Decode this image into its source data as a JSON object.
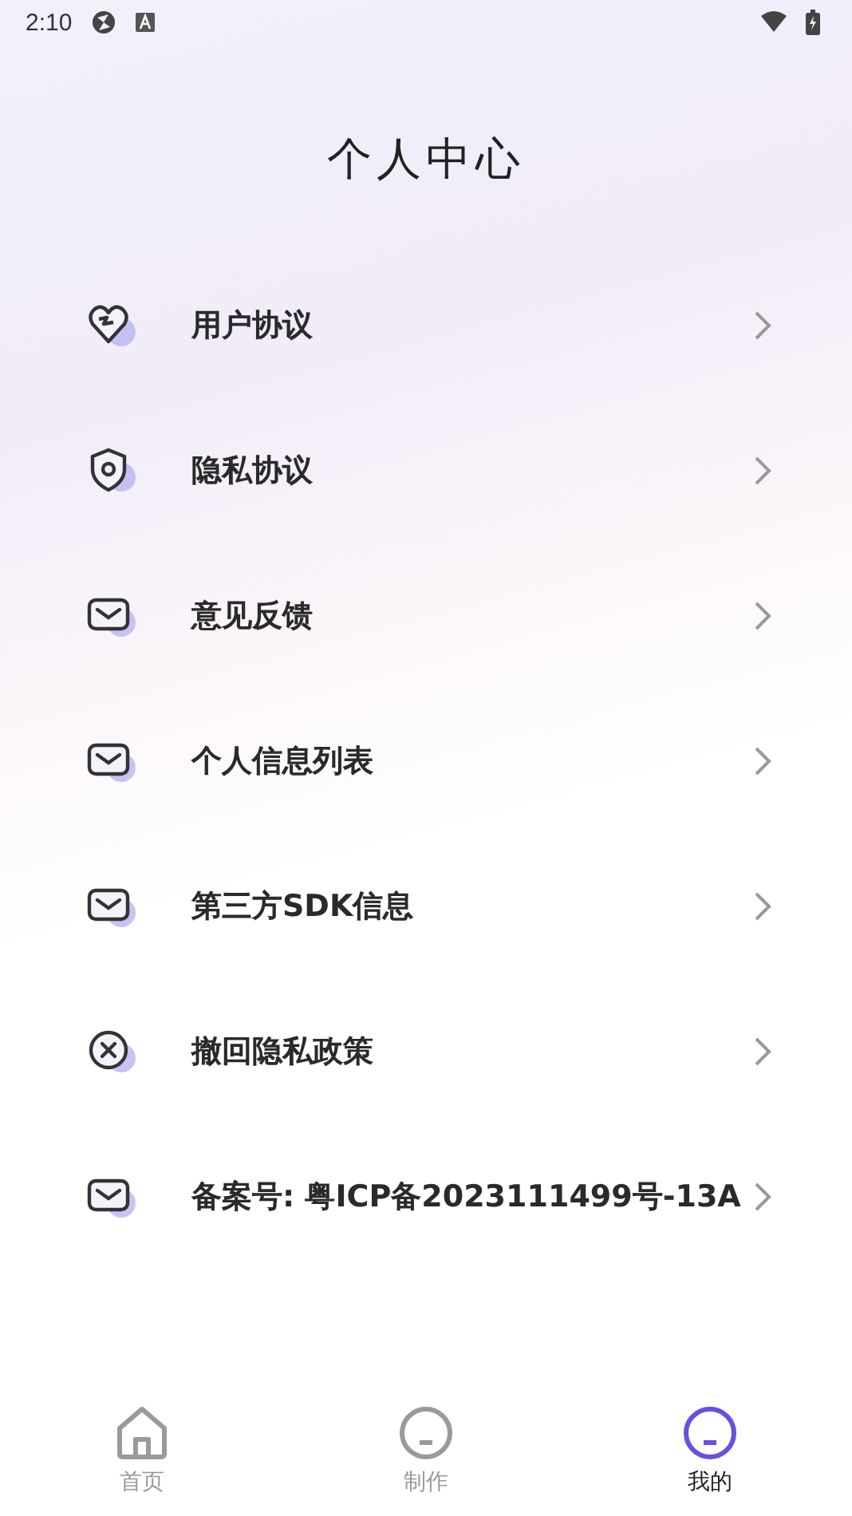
{
  "status_bar": {
    "time": "2:10"
  },
  "title": "个人中心",
  "menu": [
    {
      "kind": "heart",
      "label": "用户协议"
    },
    {
      "kind": "shield",
      "label": "隐私协议"
    },
    {
      "kind": "mail",
      "label": "意见反馈"
    },
    {
      "kind": "mail",
      "label": "个人信息列表"
    },
    {
      "kind": "mail",
      "label": "第三方SDK信息"
    },
    {
      "kind": "cancel",
      "label": "撤回隐私政策"
    },
    {
      "kind": "mail",
      "label": "备案号: 粤ICP备2023111499号-13A"
    }
  ],
  "tab_bar": [
    {
      "kind": "home",
      "label": "首页",
      "selected": false
    },
    {
      "kind": "face",
      "label": "制作",
      "selected": false
    },
    {
      "kind": "face",
      "label": "我的",
      "selected": true
    }
  ]
}
